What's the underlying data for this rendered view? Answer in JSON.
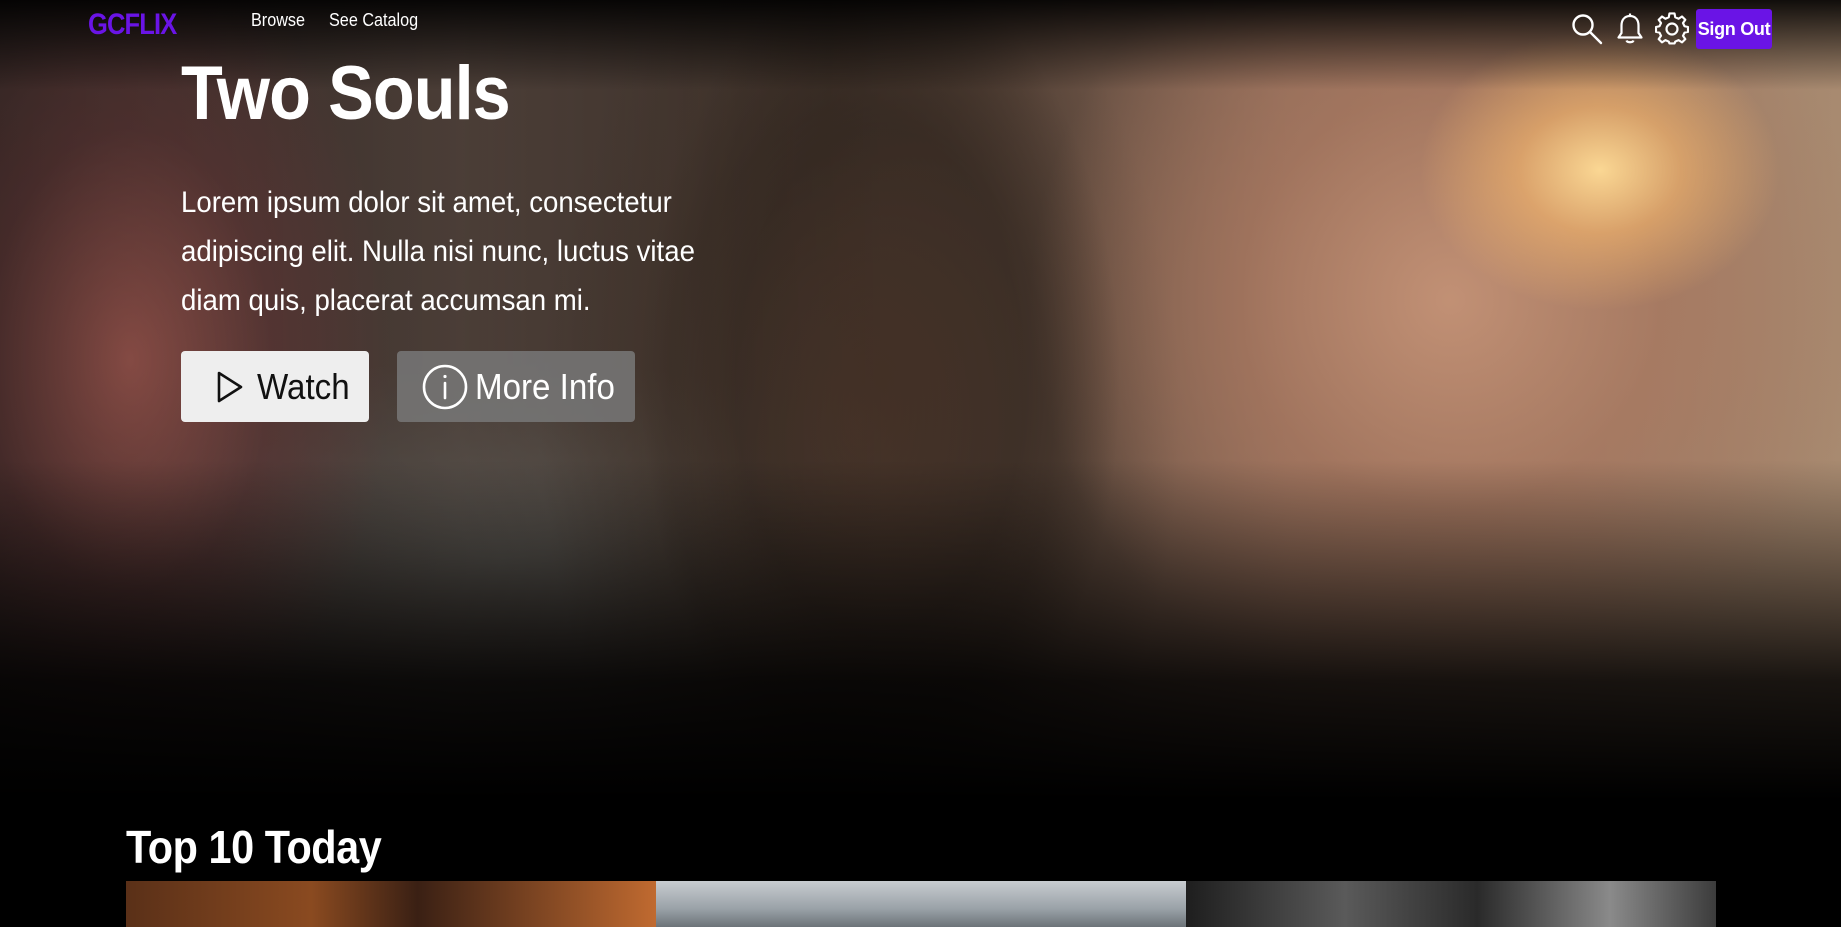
{
  "nav": {
    "logo": "GCFLIX",
    "links": [
      {
        "label": "Browse"
      },
      {
        "label": "See Catalog"
      }
    ],
    "icons": [
      "search-icon",
      "bell-icon",
      "gear-icon"
    ],
    "sign_out_label": "Sign Out",
    "accent_color": "#6a14e6"
  },
  "hero": {
    "title": "Two Souls",
    "description": "Lorem ipsum dolor sit amet, consectetur adipiscing elit. Nulla nisi nunc, luctus vitae diam quis, placerat accumsan mi.",
    "watch_label": "Watch",
    "more_info_label": "More Info"
  },
  "rows": [
    {
      "title": "Top 10 Today"
    }
  ]
}
